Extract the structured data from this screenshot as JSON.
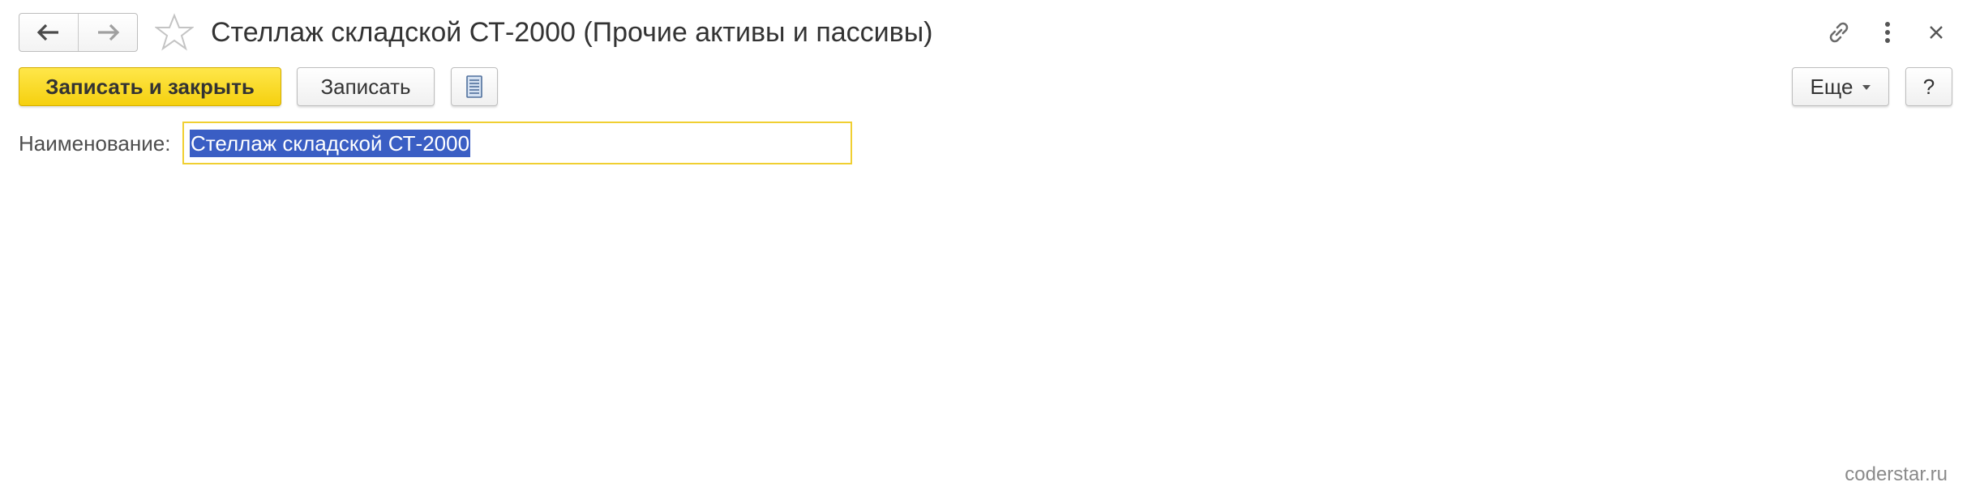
{
  "window": {
    "title": "Стеллаж складской СТ-2000 (Прочие активы и пассивы)"
  },
  "navigation": {
    "back_icon": "arrow-left-icon",
    "forward_icon": "arrow-right-icon",
    "favorite_icon": "star-outline-icon"
  },
  "header_actions": {
    "link_icon": "link-icon",
    "more_icon": "vertical-dots-icon",
    "close_icon": "close-icon"
  },
  "toolbar": {
    "save_close_label": "Записать и закрыть",
    "save_label": "Записать",
    "report_icon": "document-list-icon",
    "more_label": "Еще",
    "help_label": "?"
  },
  "form": {
    "name_label": "Наименование:",
    "name_value": "Стеллаж складской СТ-2000"
  },
  "watermark": "coderstar.ru",
  "colors": {
    "primary_button": "#f5d00f",
    "input_focus_border": "#f0cf32",
    "selection": "#3a5ec4"
  }
}
